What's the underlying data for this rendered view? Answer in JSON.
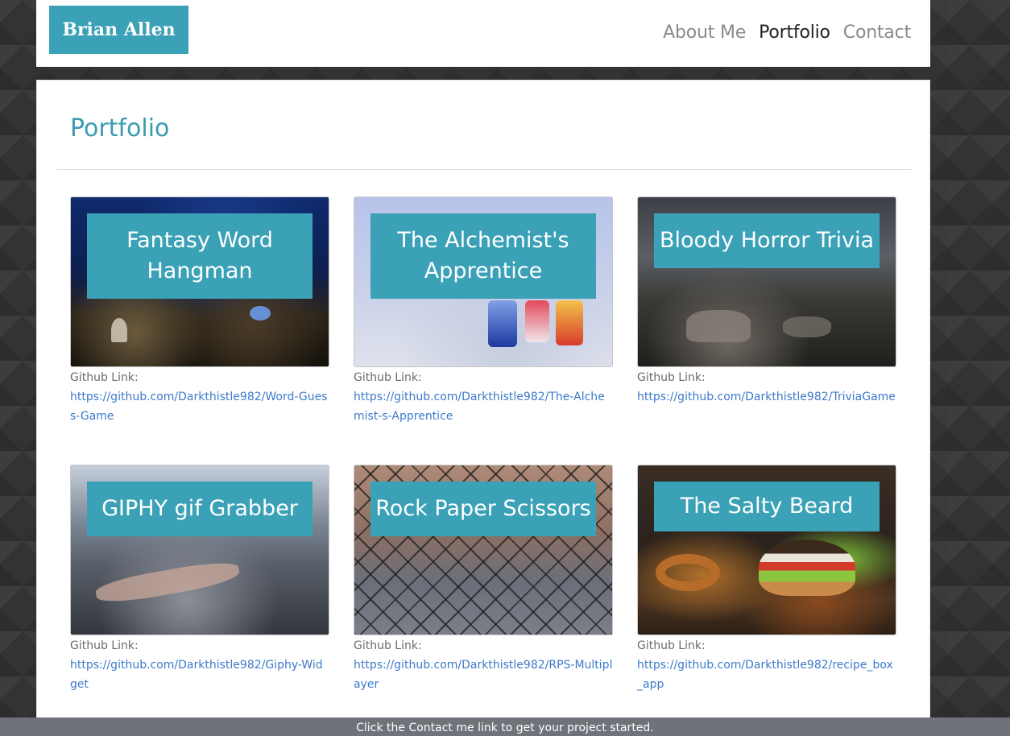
{
  "header": {
    "brand": "Brian Allen",
    "nav": [
      {
        "label": "About Me",
        "active": false
      },
      {
        "label": "Portfolio",
        "active": true
      },
      {
        "label": "Contact",
        "active": false
      }
    ]
  },
  "main": {
    "title": "Portfolio",
    "link_label": "Github Link:",
    "projects": [
      {
        "title": "Fantasy Word Hangman",
        "link": "https://github.com/Darkthistle982/Word-Guess-Game"
      },
      {
        "title": "The Alchemist's Apprentice",
        "link": "https://github.com/Darkthistle982/The-Alchemist-s-Apprentice"
      },
      {
        "title": "Bloody Horror Trivia",
        "link": "https://github.com/Darkthistle982/TriviaGame"
      },
      {
        "title": "GIPHY gif Grabber",
        "link": "https://github.com/Darkthistle982/Giphy-Widget"
      },
      {
        "title": "Rock Paper Scissors",
        "link": "https://github.com/Darkthistle982/RPS-Multiplayer"
      },
      {
        "title": "The Salty Beard",
        "link": "https://github.com/Darkthistle982/recipe_box_app"
      }
    ]
  },
  "footer": {
    "text": "Click the Contact me link to get your project started."
  },
  "colors": {
    "accent": "#3aa1b6",
    "link": "#3c7ac9",
    "footer_bg": "#6e7379"
  }
}
